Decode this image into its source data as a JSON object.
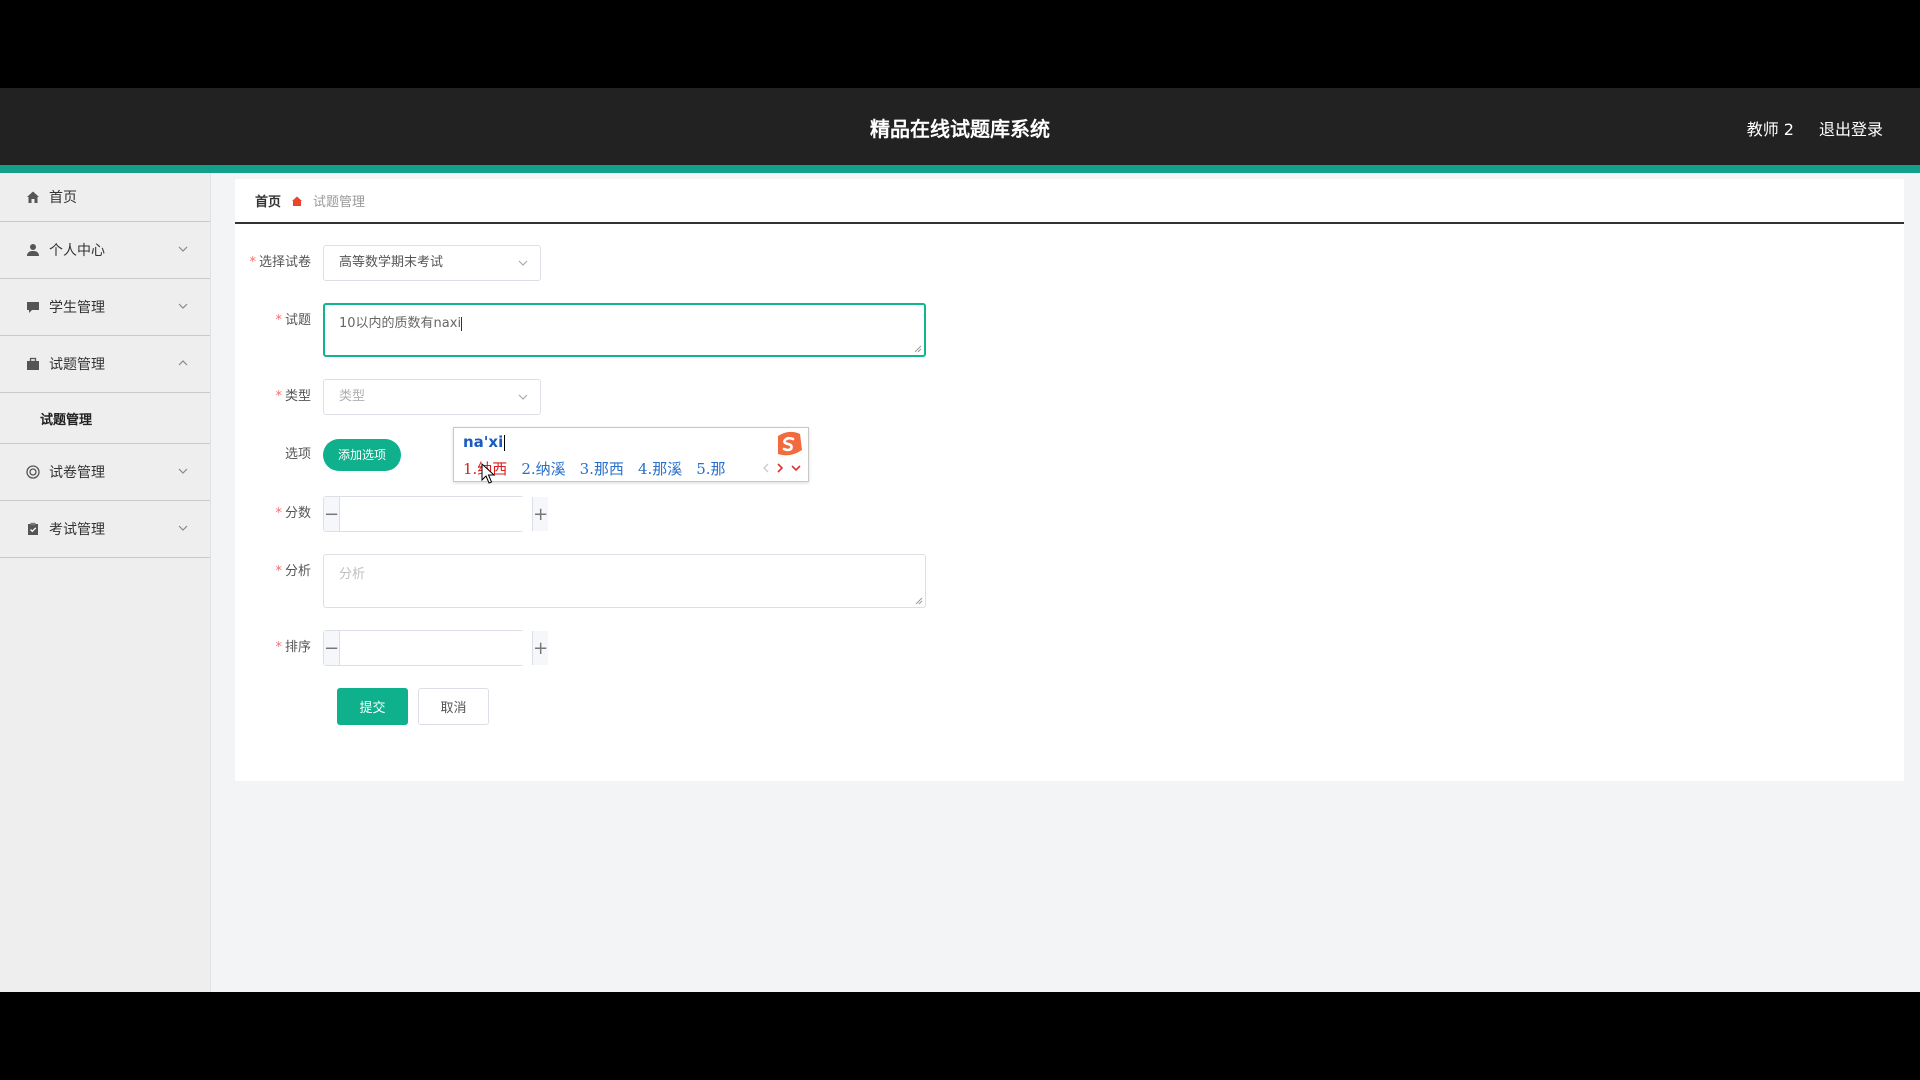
{
  "header": {
    "title": "精品在线试题库系统",
    "user": "教师 2",
    "logout": "退出登录"
  },
  "sidebar": {
    "items": [
      {
        "label": "首页",
        "icon": "home-icon"
      },
      {
        "label": "个人中心",
        "icon": "user-icon"
      },
      {
        "label": "学生管理",
        "icon": "chat-icon"
      },
      {
        "label": "试题管理",
        "icon": "briefcase-icon",
        "expanded": true,
        "children": [
          {
            "label": "试题管理"
          }
        ]
      },
      {
        "label": "试卷管理",
        "icon": "target-icon"
      },
      {
        "label": "考试管理",
        "icon": "clipboard-icon"
      }
    ]
  },
  "breadcrumb": {
    "home": "首页",
    "current": "试题管理"
  },
  "form": {
    "paper": {
      "label": "选择试卷",
      "value": "高等数学期末考试"
    },
    "question": {
      "label": "试题",
      "value": "10以内的质数有naxi"
    },
    "type": {
      "label": "类型",
      "placeholder": "类型"
    },
    "options": {
      "label": "选项",
      "add_button": "添加选项"
    },
    "score": {
      "label": "分数",
      "value": ""
    },
    "analysis": {
      "label": "分析",
      "placeholder": "分析"
    },
    "order": {
      "label": "排序",
      "value": ""
    },
    "submit": "提交",
    "cancel": "取消"
  },
  "ime": {
    "pinyin": "na'xi",
    "candidates": [
      "1.纳西",
      "2.纳溪",
      "3.那西",
      "4.那溪",
      "5.那"
    ],
    "selected_index": 0
  },
  "colors": {
    "accent": "#0fb08c",
    "header_bg": "#222222",
    "teal_bar": "#12a08a",
    "required_star": "#f56c6c"
  }
}
